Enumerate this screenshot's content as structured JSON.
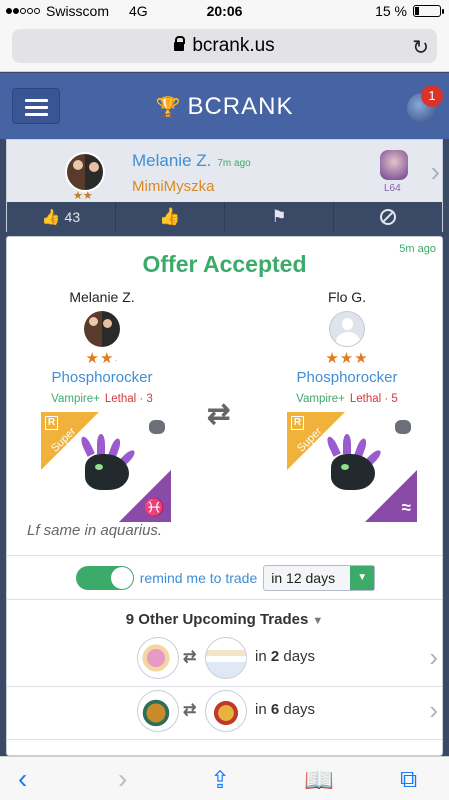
{
  "status_bar": {
    "carrier": "Swisscom",
    "network": "4G",
    "time": "20:06",
    "battery": "15 %",
    "battery_level_pct": 15
  },
  "browser": {
    "url": "bcrank.us"
  },
  "app": {
    "brand": "BCRANK",
    "notification_count": "1",
    "accent_color": "#4663a3"
  },
  "user_card": {
    "name": "Melanie Z.",
    "time": "7m ago",
    "nickname": "MimiMyszka",
    "stars": "★★",
    "level": "L64",
    "likes": "43"
  },
  "offer": {
    "time": "5m ago",
    "title": "Offer Accepted",
    "left": {
      "user": "Melanie Z.",
      "stars": "★★",
      "dragon": "Phosphorocker",
      "trait1": "Vampire+",
      "trait2": "Lethal · 3",
      "rarity": "R",
      "badge": "Super",
      "element_symbol": "♓"
    },
    "right": {
      "user": "Flo G.",
      "stars": "★★★",
      "dragon": "Phosphorocker",
      "trait1": "Vampire+",
      "trait2": "Lethal · 5",
      "rarity": "R",
      "badge": "Super",
      "element_symbol": "≈"
    },
    "note": "Lf same in aquarius.",
    "remind_label": "remind me to trade",
    "remind_on": true,
    "remind_option": "in 12 days"
  },
  "upcoming": {
    "heading": "9 Other Upcoming Trades",
    "items": [
      {
        "prefix": "in ",
        "number": "2",
        "suffix": " days"
      },
      {
        "prefix": "in ",
        "number": "6",
        "suffix": " days"
      }
    ]
  }
}
